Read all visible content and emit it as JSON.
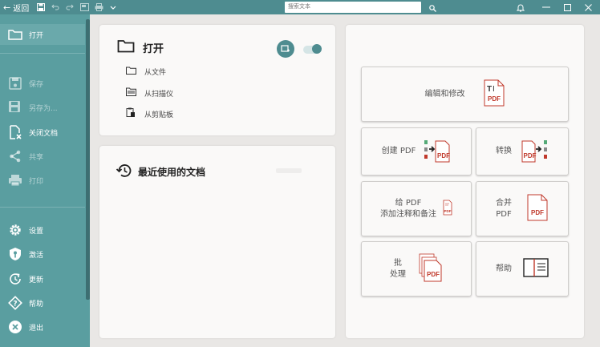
{
  "titlebar": {
    "back_label": "返回",
    "search_placeholder": "搜索文本"
  },
  "sidebar": {
    "items": [
      {
        "label": "打开",
        "icon": "folder-icon",
        "state": "active"
      },
      {
        "label": "保存",
        "icon": "save-icon",
        "state": "disabled"
      },
      {
        "label": "另存为...",
        "icon": "save-as-icon",
        "state": "disabled"
      },
      {
        "label": "关闭文档",
        "icon": "close-document-icon",
        "state": "normal"
      },
      {
        "label": "共享",
        "icon": "share-icon",
        "state": "disabled"
      },
      {
        "label": "打印",
        "icon": "print-icon",
        "state": "disabled"
      },
      {
        "label": "设置",
        "icon": "gear-icon",
        "state": "normal"
      },
      {
        "label": "激活",
        "icon": "shield-key-icon",
        "state": "normal"
      },
      {
        "label": "更新",
        "icon": "refresh-icon",
        "state": "normal"
      },
      {
        "label": "帮助",
        "icon": "help-icon",
        "state": "normal"
      },
      {
        "label": "退出",
        "icon": "exit-icon",
        "state": "normal"
      }
    ]
  },
  "open_panel": {
    "title": "打开",
    "options": [
      {
        "label": "从文件",
        "icon": "folder-small-icon"
      },
      {
        "label": "从扫描仪",
        "icon": "scanner-icon"
      },
      {
        "label": "从剪贴板",
        "icon": "clipboard-icon"
      }
    ]
  },
  "recent_panel": {
    "title": "最近使用的文档"
  },
  "actions": {
    "edit": "编辑和修改",
    "create": "创建 PDF",
    "convert": "转换",
    "annotate_line1": "给 PDF",
    "annotate_line2": "添加注释和备注",
    "merge_line1": "合并",
    "merge_line2": "PDF",
    "batch_line1": "批",
    "batch_line2": "处理",
    "help": "帮助",
    "pdf_badge": "PDF"
  },
  "colors": {
    "accent": "#4e8c90",
    "sidebar": "#5a9ea0",
    "pdf_red": "#c0392b"
  }
}
